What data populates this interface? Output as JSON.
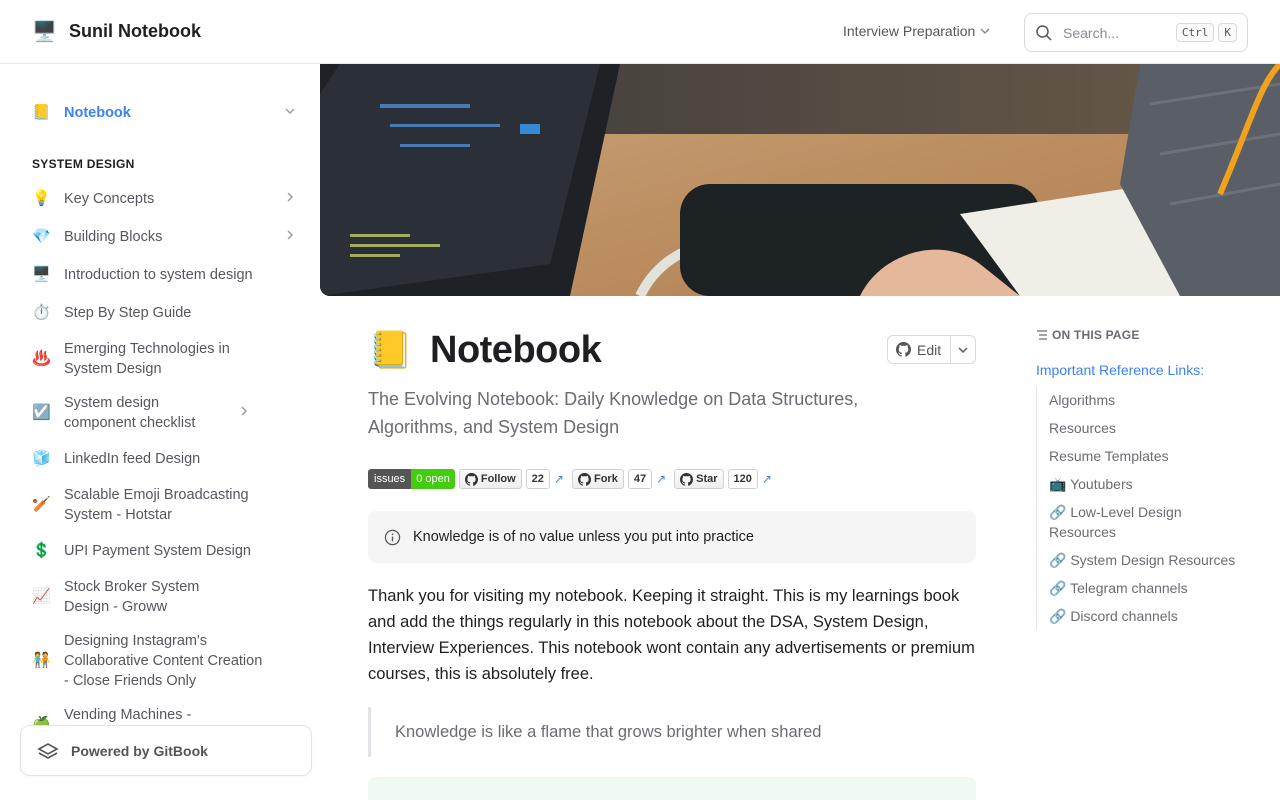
{
  "header": {
    "logo_icon": "🖥️",
    "title": "Sunil Notebook",
    "space": "Interview Preparation",
    "search_placeholder": "Search...",
    "kbd_ctrl": "Ctrl",
    "kbd_k": "K"
  },
  "sidebar": {
    "top_item": {
      "icon": "📒",
      "label": "Notebook"
    },
    "section": "SYSTEM DESIGN",
    "items": [
      {
        "icon": "💡",
        "label": "Key Concepts"
      },
      {
        "icon": "💎",
        "label": "Building Blocks"
      },
      {
        "icon": "🖥️",
        "label": "Introduction to system design"
      },
      {
        "icon": "⏱️",
        "label": "Step By Step Guide"
      },
      {
        "icon": "♨️",
        "label": "Emerging Technologies in System Design"
      },
      {
        "icon": "☑️",
        "label": "System design component checklist"
      },
      {
        "icon": "🧊",
        "label": "LinkedIn feed Design"
      },
      {
        "icon": "🏏",
        "label": "Scalable Emoji Broadcasting System - Hotstar"
      },
      {
        "icon": "💲",
        "label": "UPI Payment System Design"
      },
      {
        "icon": "📈",
        "label": "Stock Broker System Design - Groww"
      },
      {
        "icon": "🧑‍🤝‍🧑",
        "label": "Designing Instagram's Collaborative Content Creation - Close Friends Only"
      },
      {
        "icon": "🍏",
        "label": "Vending Machines -"
      }
    ],
    "powered": "Powered by GitBook"
  },
  "page": {
    "icon": "📒",
    "title": "Notebook",
    "edit": "Edit",
    "subtitle": "The Evolving Notebook: Daily Knowledge on Data Structures, Algorithms, and System Design",
    "badges": {
      "issues_label": "issues",
      "issues_value": "0 open",
      "follow": "Follow",
      "follow_count": "22",
      "fork": "Fork",
      "fork_count": "47",
      "star": "Star",
      "star_count": "120"
    },
    "hint": "Knowledge is of no value unless you put into practice",
    "paragraph": "Thank you for visiting my notebook. Keeping it straight. This is my learnings book and add the things regularly in this notebook about the DSA, System Design, Interview Experiences. This notebook wont contain any advertisements or premium courses, this is absolutely free.",
    "quote": "Knowledge is like a flame that grows brighter when shared"
  },
  "toc": {
    "heading": "ON THIS PAGE",
    "main": "Important Reference Links:",
    "items": [
      "Algorithms",
      "Resources",
      "Resume Templates",
      "📺 Youtubers",
      "🔗 Low-Level Design Resources",
      "🔗 System Design Resources",
      "🔗 Telegram channels",
      "🔗 Discord channels"
    ]
  },
  "colors": {
    "accent": "#3b82f6",
    "badge_green": "#44cc11"
  }
}
